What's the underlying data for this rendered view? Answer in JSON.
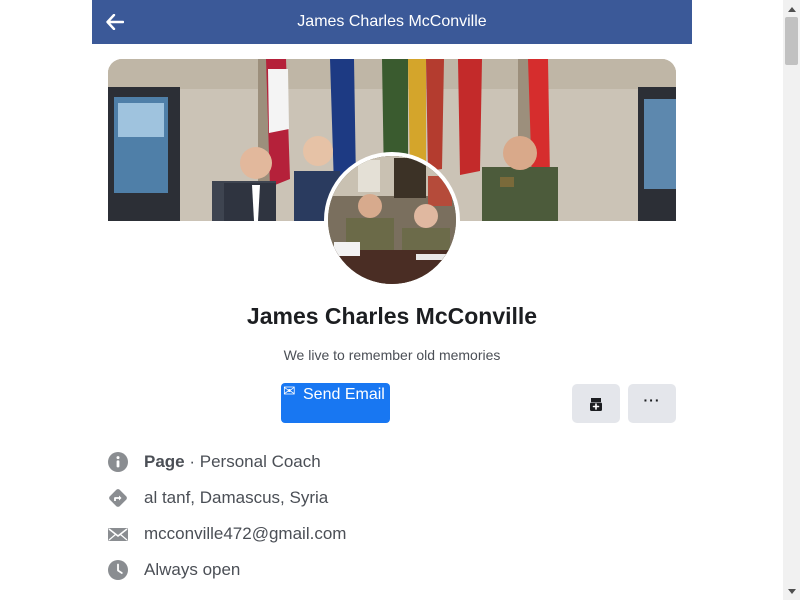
{
  "header": {
    "title": "James Charles McConville",
    "back_icon": "arrow-left-icon",
    "background_color": "#3b5998"
  },
  "profile": {
    "name": "James Charles McConville",
    "bio": "We live to remember old memories"
  },
  "actions": {
    "send_email_label": "Send Email",
    "send_email_icon": "envelope-icon",
    "send_email_color": "#1877f2",
    "save_icon": "bookmark-add-icon",
    "more_label": "···"
  },
  "info": {
    "page_label": "Page",
    "separator": " · ",
    "category": "Personal Coach",
    "location": "al tanf, Damascus, Syria",
    "email": "mcconville472@gmail.com",
    "hours": "Always open"
  }
}
